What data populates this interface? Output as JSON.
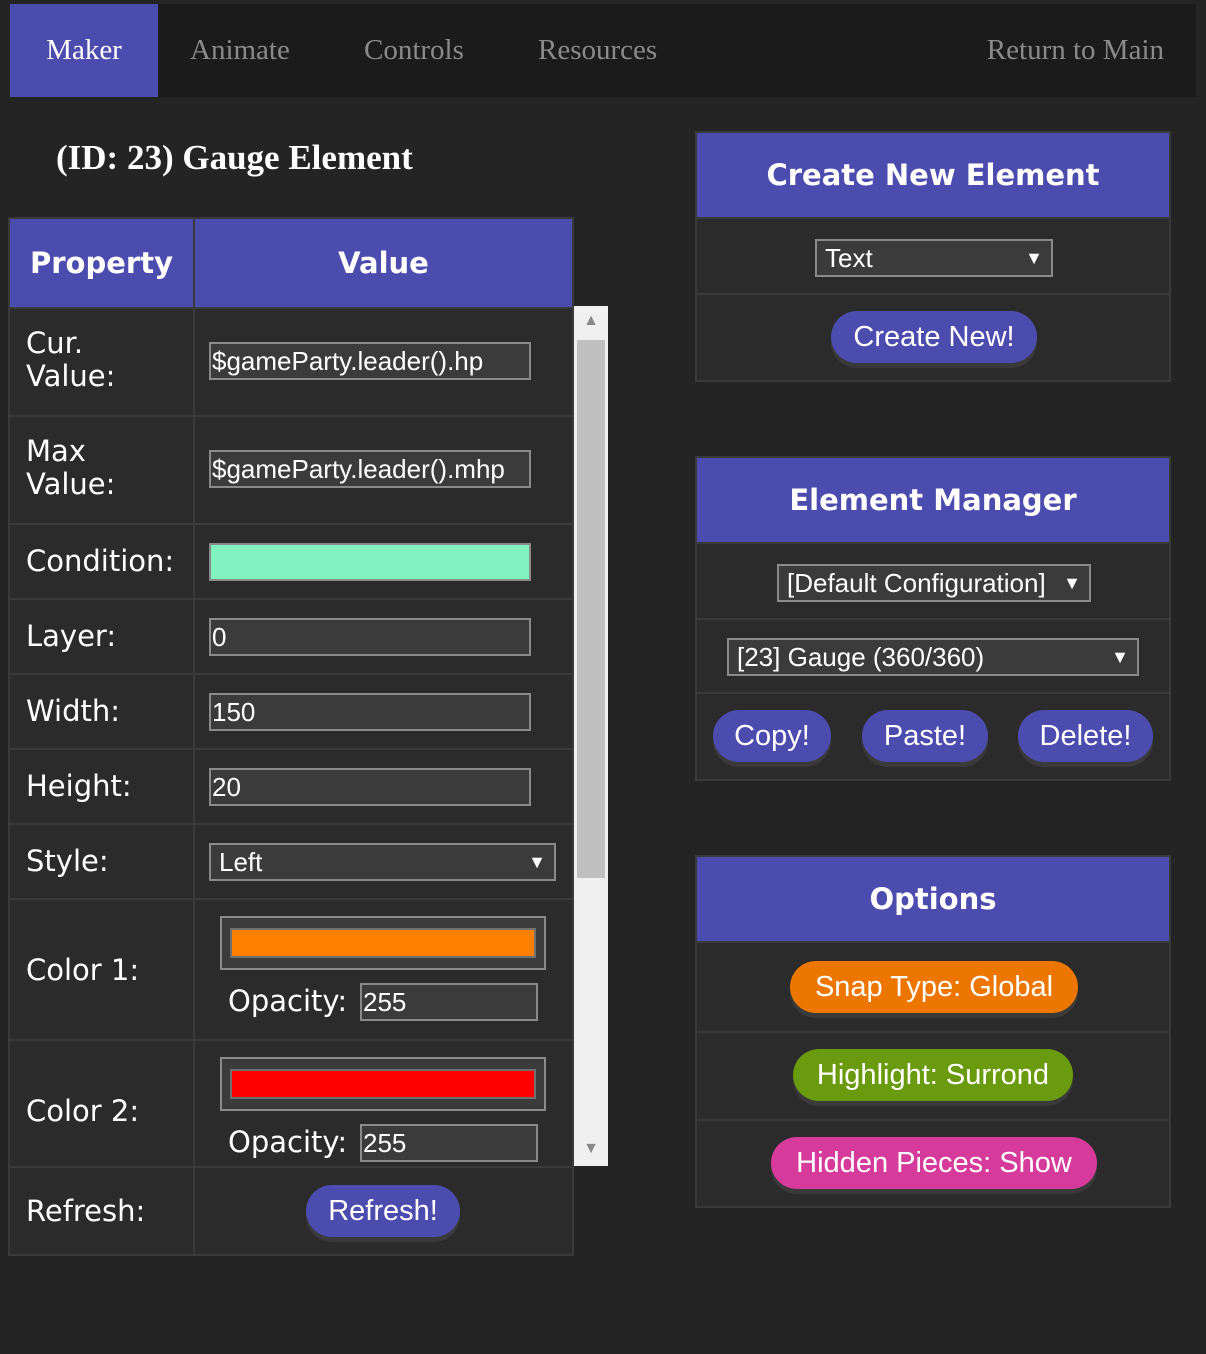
{
  "nav": {
    "tabs": [
      {
        "label": "Maker",
        "active": true
      },
      {
        "label": "Animate",
        "active": false
      },
      {
        "label": "Controls",
        "active": false
      },
      {
        "label": "Resources",
        "active": false
      }
    ],
    "return_label": "Return to Main"
  },
  "title": "(ID: 23) Gauge Element",
  "table": {
    "header_property": "Property",
    "header_value": "Value",
    "cur_value": {
      "label": "Cur.\nValue:",
      "value": "$gameParty.leader().hp"
    },
    "max_value": {
      "label": "Max\nValue:",
      "value": "$gameParty.leader().mhp"
    },
    "condition": {
      "label": "Condition:",
      "value": "",
      "color": "#82f3c0"
    },
    "layer": {
      "label": "Layer:",
      "value": "0"
    },
    "width": {
      "label": "Width:",
      "value": "150"
    },
    "height": {
      "label": "Height:",
      "value": "20"
    },
    "style": {
      "label": "Style:",
      "value": "Left"
    },
    "color1": {
      "label": "Color 1:",
      "color": "#ff8000",
      "opacity_label": "Opacity:",
      "opacity": "255"
    },
    "color2": {
      "label": "Color 2:",
      "color": "#ff0000",
      "opacity_label": "Opacity:",
      "opacity": "255"
    },
    "refresh": {
      "label": "Refresh:",
      "button": "Refresh!"
    }
  },
  "create_panel": {
    "title": "Create New Element",
    "type_value": "Text",
    "create_button": "Create New!"
  },
  "manager_panel": {
    "title": "Element Manager",
    "config_value": "[Default Configuration]",
    "element_value": "[23] Gauge (360/360)",
    "copy_button": "Copy!",
    "paste_button": "Paste!",
    "delete_button": "Delete!"
  },
  "options_panel": {
    "title": "Options",
    "snap_button": "Snap Type: Global",
    "highlight_button": "Highlight: Surrond",
    "hidden_button": "Hidden Pieces: Show"
  },
  "colors": {
    "accent": "#4c4caf",
    "snap": "#ec7600",
    "highlight": "#6a9b0e",
    "hidden": "#d63b9c"
  }
}
